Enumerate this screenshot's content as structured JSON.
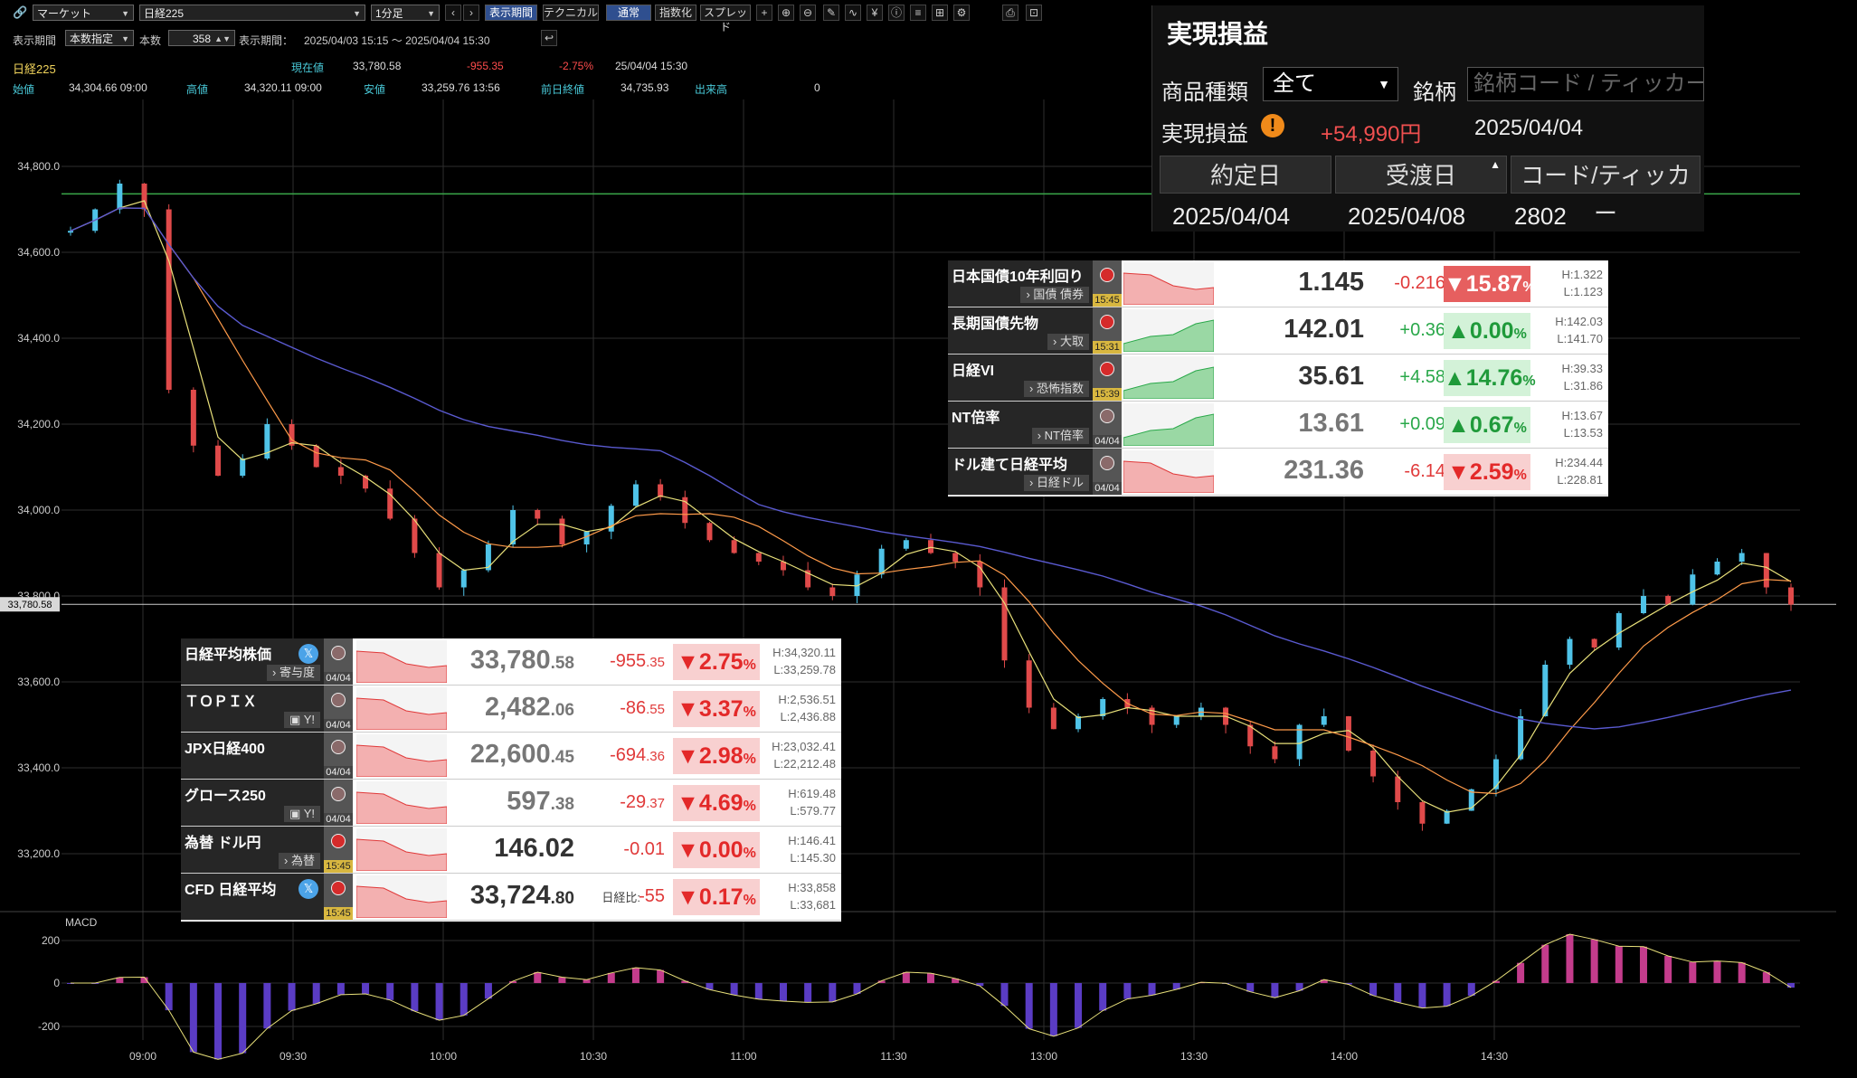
{
  "toolbar": {
    "link_icon": "link-icon",
    "market_select": "マーケット",
    "symbol_select": "日経225",
    "interval_select": "1分足",
    "period_button": "表示期間",
    "technical_button": "テクニカル",
    "normal_button": "通常",
    "index_button": "指数化",
    "spread_button": "スプレッド"
  },
  "row2": {
    "period_label": "表示期間",
    "period_mode": "本数指定",
    "count_label": "本数",
    "count_value": "358",
    "range_label": "表示期間：",
    "range_value": "2025/04/03 15:15 ～ 2025/04/04 15:30"
  },
  "quote_header": {
    "name": "日経225",
    "current_label": "現在値",
    "current_value": "33,780.58",
    "change": "-955.35",
    "change_pct": "-2.75%",
    "time": "25/04/04 15:30",
    "open_label": "始値",
    "open_value": "34,304.66 09:00",
    "high_label": "高値",
    "high_value": "34,320.11 09:00",
    "low_label": "安値",
    "low_value": "33,259.76 13:56",
    "prev_label": "前日終値",
    "prev_value": "34,735.93",
    "volume_label": "出来高",
    "volume_value": "0"
  },
  "chart_data": {
    "type": "line",
    "title": "",
    "x_ticks": [
      "09:00",
      "09:30",
      "10:00",
      "10:30",
      "11:00",
      "11:30",
      "13:00",
      "13:30",
      "14:00",
      "14:30"
    ],
    "y_ticks": [
      "34,800.0",
      "34,600.0",
      "34,400.0",
      "34,200.0",
      "34,000.0",
      "33,800.0",
      "33,600.0",
      "33,400.0",
      "33,200.0"
    ],
    "ylim": [
      33200,
      34800
    ],
    "current_price_label": "33,780.58",
    "series": [
      {
        "values": [
          34650,
          34700,
          34760,
          34700,
          34280,
          34150,
          34080,
          34120,
          34200,
          34150,
          34100,
          34080,
          34050,
          33980,
          33900,
          33820,
          33860,
          33920,
          34000,
          33980,
          33920,
          33950,
          34010,
          34060,
          34030,
          33970,
          33930,
          33900,
          33880,
          33860,
          33820,
          33800,
          33850,
          33910,
          33930,
          33900,
          33880,
          33820,
          33650,
          33540,
          33490,
          33520,
          33560,
          33540,
          33500,
          33520,
          33540,
          33500,
          33450,
          33420,
          33500,
          33520,
          33440,
          33380,
          33320,
          33270,
          33300,
          33350,
          33420,
          33520,
          33640,
          33700,
          33680,
          33760,
          33800,
          33780,
          33850,
          33880,
          33900,
          33820,
          33780
        ]
      }
    ],
    "macd_label": "MACD",
    "macd_ticks": [
      "200",
      "0",
      "-200"
    ]
  },
  "pl_panel": {
    "title": "実現損益",
    "type_label": "商品種類",
    "type_value": "全て",
    "symbol_label": "銘柄",
    "symbol_placeholder": "銘柄コード / ティッカー / 銘",
    "pl_label": "実現損益",
    "pl_value": "+54,990円",
    "pl_date": "2025/04/04",
    "col_trade_date": "約定日",
    "col_delivery_date": "受渡日",
    "col_code": "コード/ティッカー",
    "row_trade_date": "2025/04/04",
    "row_delivery_date": "2025/04/08",
    "row_code": "2802"
  },
  "bonds_widget": [
    {
      "name": "日本国債10年利回り",
      "sub": "国債 債券",
      "time": "15:45",
      "price": "1.145",
      "change": "-0.216",
      "pct": "15.87",
      "dir": "down",
      "high": "H:1.322",
      "low": "L:1.123"
    },
    {
      "name": "長期国債先物",
      "sub": "大取",
      "time": "15:31",
      "price": "142.01",
      "change": "+0.36",
      "pct": "0.00",
      "dir": "up",
      "high": "H:142.03",
      "low": "L:141.70"
    },
    {
      "name": "日経VI",
      "sub": "恐怖指数",
      "time": "15:39",
      "price": "35.61",
      "change": "+4.58",
      "pct": "14.76",
      "dir": "up",
      "high": "H:39.33",
      "low": "L:31.86"
    },
    {
      "name": "NT倍率",
      "sub": "NT倍率",
      "time": "04/04",
      "price": "13.61",
      "change": "+0.09",
      "pct": "0.67",
      "dir": "up",
      "high": "H:13.67",
      "low": "L:13.53"
    },
    {
      "name": "ドル建て日経平均",
      "sub": "日経ドル",
      "time": "04/04",
      "price": "231.36",
      "change": "-6.14",
      "pct": "2.59",
      "dir": "down",
      "high": "H:234.44",
      "low": "L:228.81"
    }
  ],
  "index_widget": [
    {
      "name": "日経平均株価",
      "sub": "寄与度",
      "time": "04/04",
      "price_int": "33,780",
      "price_dec": ".58",
      "change_int": "-955",
      "change_dec": ".35",
      "pct": "2.75",
      "high": "H:34,320.11",
      "low": "L:33,259.78"
    },
    {
      "name": "ＴＯＰＩＸ",
      "sub": "Y!",
      "time": "04/04",
      "price_int": "2,482",
      "price_dec": ".06",
      "change_int": "-86",
      "change_dec": ".55",
      "pct": "3.37",
      "high": "H:2,536.51",
      "low": "L:2,436.88"
    },
    {
      "name": "JPX日経400",
      "sub": "",
      "time": "04/04",
      "price_int": "22,600",
      "price_dec": ".45",
      "change_int": "-694",
      "change_dec": ".36",
      "pct": "2.98",
      "high": "H:23,032.41",
      "low": "L:22,212.48"
    },
    {
      "name": "グロース250",
      "sub": "Y!",
      "time": "04/04",
      "price_int": "597",
      "price_dec": ".38",
      "change_int": "-29",
      "change_dec": ".37",
      "pct": "4.69",
      "high": "H:619.48",
      "low": "L:579.77"
    },
    {
      "name": "為替 ドル円",
      "sub": "為替",
      "time": "15:45",
      "price_int": "146.02",
      "price_dec": "",
      "change_int": "-0.01",
      "change_dec": "",
      "pct": "0.00",
      "high": "H:146.41",
      "low": "L:145.30"
    },
    {
      "name": "CFD 日経平均",
      "sub": "",
      "time": "15:45",
      "price_int": "33,724",
      "price_dec": ".80",
      "ratio_label": "日経比:",
      "change_int": "-55",
      "change_dec": "",
      "pct": "0.17",
      "high": "H:33,858",
      "low": "L:33,681"
    }
  ],
  "colors": {
    "up": "#4fc3e8",
    "down": "#e04a4a",
    "sma_short": "#ff9b4a",
    "sma_mid": "#e8e07a",
    "sma_long": "#5a5ad0",
    "macd_pos": "#c43c8c",
    "macd_neg": "#5a3cc4"
  }
}
